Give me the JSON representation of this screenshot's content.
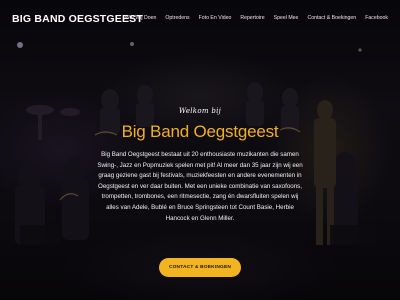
{
  "site": {
    "logo_text": "BIG BAND OEGSTGEEST"
  },
  "nav": {
    "items": [
      {
        "label": "Wat Wij Doen"
      },
      {
        "label": "Optredens"
      },
      {
        "label": "Foto En Video"
      },
      {
        "label": "Repertoire"
      },
      {
        "label": "Speel Mee"
      },
      {
        "label": "Contact & Boekingen"
      },
      {
        "label": "Facebook"
      }
    ]
  },
  "hero": {
    "welcome": "Welkom bij",
    "headline": "Big Band Oegstgeest",
    "description": "Big Band Oegstgeest bestaat uit 20 enthousiaste muzikanten die samen Swing-, Jazz en Popmuziek spelen met pit! Al meer dan 35 jaar zijn wij een graag geziene gast bij festivals, muziekfeesten en andere evenementen in Oegstgeest en ver daar buiten. Met een unieke combinatie van saxofoons, trompetten, trombones, een ritmesectie, zang én dwarsfluiten spelen wij alles van Adele, Bublé en Bruce Springsteen tot Count Basie, Herbie Hancock en Glenn Miller.",
    "cta_label": "CONTACT & BOEKINGEN"
  },
  "colors": {
    "accent": "#f2b021",
    "button_bg": "#f2b521",
    "background": "#000000"
  }
}
